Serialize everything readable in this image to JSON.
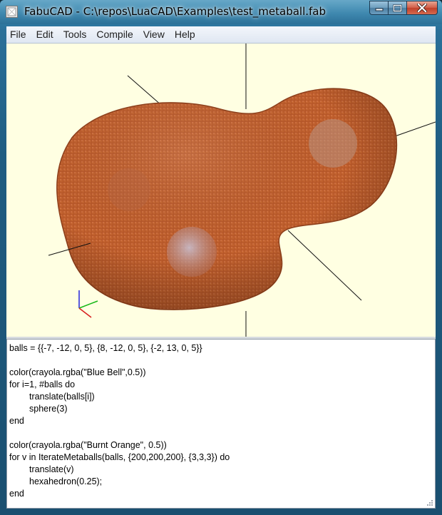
{
  "window": {
    "title": "FabuCAD - C:\\repos\\LuaCAD\\Examples\\test_metaball.fab",
    "controls": [
      "minimize-icon",
      "maximize-icon",
      "close-icon"
    ]
  },
  "menubar": {
    "items": [
      "File",
      "Edit",
      "Tools",
      "Compile",
      "View",
      "Help"
    ]
  },
  "viewport": {
    "background": "#ffffe2",
    "body_color": "#b8592a",
    "sphere_color": "#b8b2c8",
    "axis_colors": {
      "x": "#d81e1e",
      "y": "#18b818",
      "z": "#2222dd"
    }
  },
  "editor": {
    "lines": [
      {
        "text": "balls = {{-7, -12, 0, 5}, {8, -12, 0, 5}, {-2, 13, 0, 5}}",
        "indent": false
      },
      {
        "text": "",
        "indent": false
      },
      {
        "text": "color(crayola.rgba(\"Blue Bell\",0.5))",
        "indent": false
      },
      {
        "text": "for i=1, #balls do",
        "indent": false
      },
      {
        "text": "translate(balls[i])",
        "indent": true
      },
      {
        "text": "sphere(3)",
        "indent": true
      },
      {
        "text": "end",
        "indent": false
      },
      {
        "text": "",
        "indent": false
      },
      {
        "text": "color(crayola.rgba(\"Burnt Orange\", 0.5))",
        "indent": false
      },
      {
        "text": "for v in IterateMetaballs(balls, {200,200,200}, {3,3,3}) do",
        "indent": false
      },
      {
        "text": "translate(v)",
        "indent": true
      },
      {
        "text": "hexahedron(0.25);",
        "indent": true
      },
      {
        "text": "end",
        "indent": false
      }
    ]
  }
}
